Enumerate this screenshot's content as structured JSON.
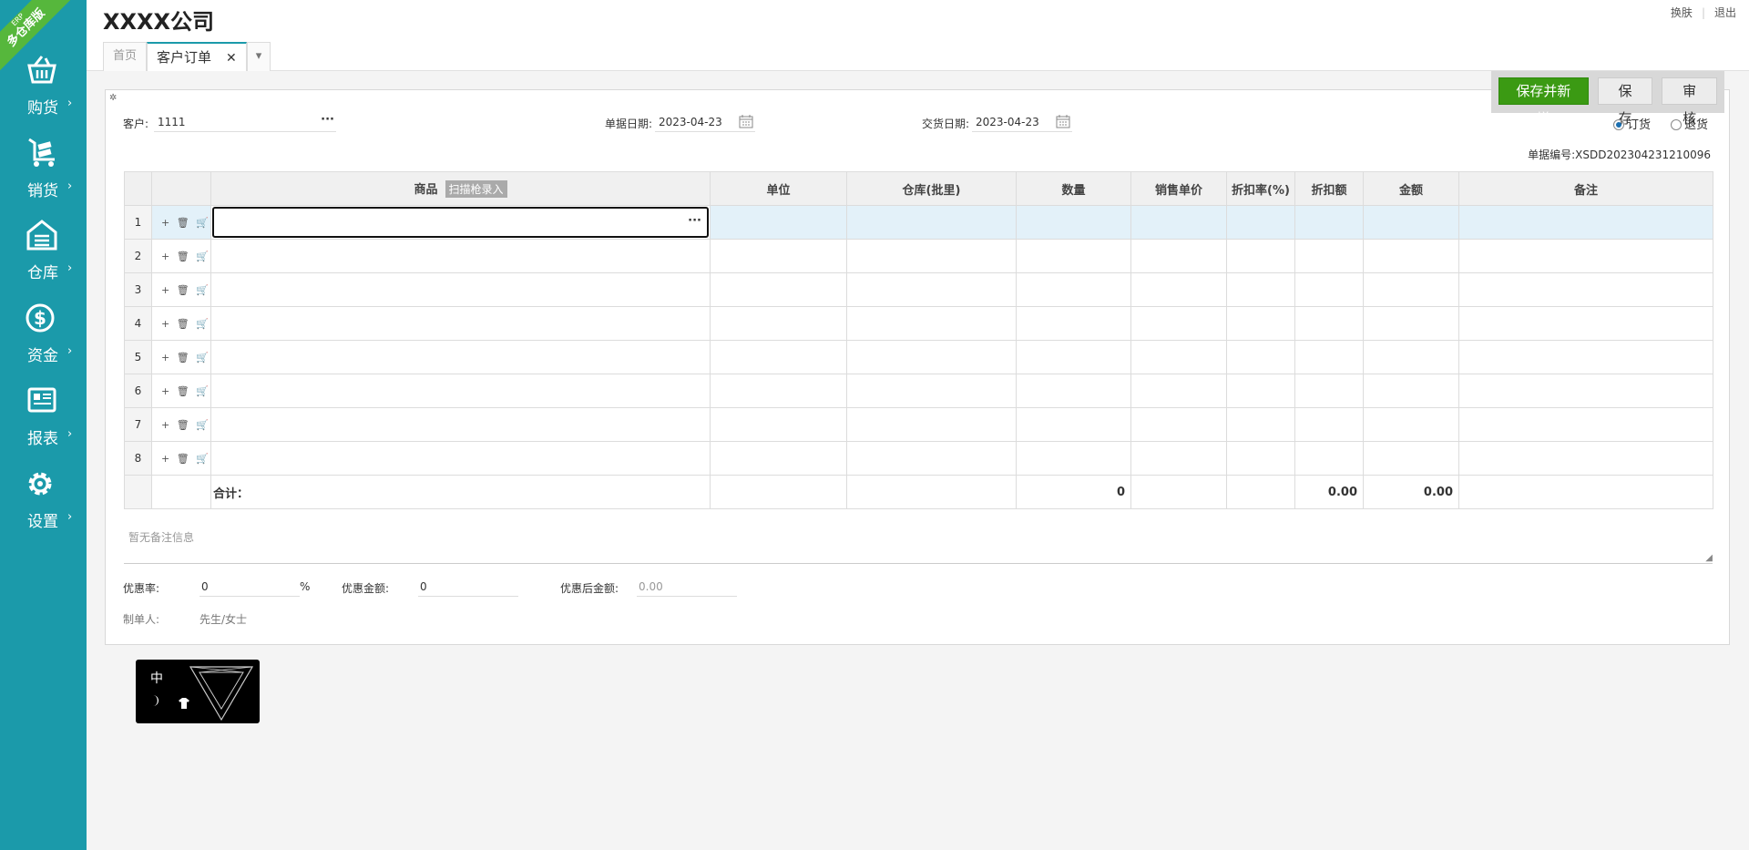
{
  "brand": {
    "ribbon_small": "ERP",
    "ribbon_big": "多仓库版"
  },
  "sidebar": {
    "items": [
      {
        "label": "购货",
        "icon": "basket-icon"
      },
      {
        "label": "销货",
        "icon": "cart-icon"
      },
      {
        "label": "仓库",
        "icon": "warehouse-icon"
      },
      {
        "label": "资金",
        "icon": "dollar-icon"
      },
      {
        "label": "报表",
        "icon": "report-icon"
      },
      {
        "label": "设置",
        "icon": "gear-icon"
      }
    ],
    "arrow": "›"
  },
  "header": {
    "company": "XXXX公司",
    "switch_skin": "换肤",
    "logout": "退出",
    "tabs": [
      {
        "label": "首页"
      },
      {
        "label": "客户订单",
        "close": "✕"
      }
    ],
    "tab_dropdown": "▾"
  },
  "actions": {
    "save_new": "保存并新增",
    "save": "保存",
    "audit": "审核"
  },
  "form": {
    "customer_label": "客户:",
    "customer_value": "1111",
    "bill_date_label": "单据日期:",
    "bill_date_value": "2023-04-23",
    "delivery_date_label": "交货日期:",
    "delivery_date_value": "2023-04-23",
    "order_type_options": [
      "订货",
      "退货"
    ],
    "order_type_selected": "订货",
    "doc_no": "单据编号:XSDD202304231210096",
    "dots": "···"
  },
  "grid": {
    "columns": [
      "商品",
      "单位",
      "仓库(批里)",
      "数量",
      "销售单价",
      "折扣率(%)",
      "折扣额",
      "金额",
      "备注"
    ],
    "scan_badge": "扫描枪录入",
    "row_numbers": [
      "1",
      "2",
      "3",
      "4",
      "5",
      "6",
      "7",
      "8"
    ],
    "row_ops": "+ 🗑 🛒",
    "total_label": "合计：",
    "total_qty": "0",
    "total_discount": "0.00",
    "total_amount": "0.00"
  },
  "remark_placeholder": "暂无备注信息",
  "footer": {
    "discount_rate_label": "优惠率:",
    "discount_rate_value": "0",
    "percent": "%",
    "discount_amount_label": "优惠金额:",
    "discount_amount_value": "0",
    "after_discount_label": "优惠后金额:",
    "after_discount_value": "0.00",
    "creator_label": "制单人:",
    "creator_value": "先生/女士"
  },
  "widget": {
    "char": "中"
  }
}
